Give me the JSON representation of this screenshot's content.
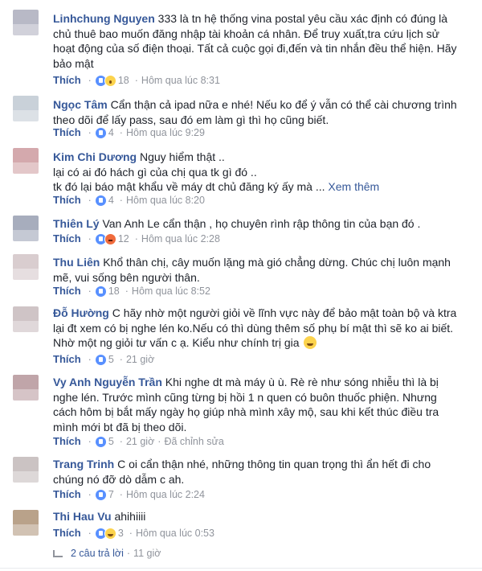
{
  "comments": [
    {
      "author": "Linhchung Nguyen",
      "lines": [
        "333 là tn hệ thống vina postal yêu cầu xác định có đúng là",
        "chủ thuê bao muốn đăng nhập tài khoản cá nhân. Để truy xuất,tra cứu lịch sử",
        "hoạt động của số điện thoại. Tất cả cuộc gọi đi,đến và tin nhắn đều thể hiện. Hãy",
        "bảo mật"
      ],
      "like": "Thích",
      "reaction_count": "18",
      "timestamp": "Hôm qua lúc 8:31",
      "reactions": [
        "like-icon",
        "wow-icon"
      ],
      "avatar_color": "#b8b9c6"
    },
    {
      "author": "Ngọc Tâm",
      "lines": [
        "Cẩn thận cả ipad nữa e nhé! Nếu ko để ý vẫn có thể cài chương trình",
        "theo dõi để lấy pass, sau đó em làm gì thì họ cũng biết."
      ],
      "like": "Thích",
      "reaction_count": "4",
      "timestamp": "Hôm qua lúc 9:29",
      "reactions": [
        "like-icon"
      ],
      "avatar_color": "#c9d1d9"
    },
    {
      "author": "Kim Chi Dương",
      "lines": [
        "Nguy hiểm thật ..",
        "lại có ai đó hách gì của chị qua tk gì đó ..",
        "tk đó lại báo mật khẩu về máy dt chủ đăng ký ấy mà ..."
      ],
      "more": "Xem thêm",
      "like": "Thích",
      "reaction_count": "4",
      "timestamp": "Hôm qua lúc 8:20",
      "reactions": [
        "like-icon"
      ],
      "avatar_color": "#d4a9ad"
    },
    {
      "author": "Thiên Lý",
      "lines": [
        "Van Anh Le cẩn thận , họ chuyên rình rập thông tin của bạn đó ."
      ],
      "like": "Thích",
      "reaction_count": "12",
      "timestamp": "Hôm qua lúc 2:28",
      "reactions": [
        "like-icon",
        "angry-icon"
      ],
      "avatar_color": "#a7adbd"
    },
    {
      "author": "Thu Liên",
      "lines": [
        "Khổ thân chị, cây muốn lặng mà gió chẳng dừng. Chúc chị luôn mạnh",
        "mẽ, vui sống bên người thân."
      ],
      "like": "Thích",
      "reaction_count": "18",
      "timestamp": "Hôm qua lúc 8:52",
      "reactions": [
        "like-icon"
      ],
      "avatar_color": "#d9cdcf"
    },
    {
      "author": "Đỗ Hường",
      "lines": [
        "C hãy nhờ một người giỏi về lĩnh vực này để bảo mật toàn bộ và ktra",
        "lại đt xem có bị nghe lén ko.Nếu có thì dùng thêm số phụ bí mật thì sẽ ko ai biết.",
        "Nhờ một ng giỏi tư vấn c ạ. Kiểu như chính trị gia"
      ],
      "like": "Thích",
      "reaction_count": "5",
      "timestamp": "21 giờ",
      "reactions": [
        "like-icon"
      ],
      "avatar_color": "#cfc4c6"
    },
    {
      "author": "Vy Anh Nguyễn Trần",
      "lines": [
        "Khi nghe dt mà máy ù ù. Rè rè như sóng nhiễu thì là bị",
        "nghe lén. Trước mình cũng từng bị hồi 1 n quen có buôn thuốc phiện. Nhưng",
        "cách hôm bị bắt mấy ngày họ giúp nhà mình xây mộ, sau khi kết thúc điều tra",
        "mình mới bt đã bị theo dõi."
      ],
      "like": "Thích",
      "reaction_count": "5",
      "timestamp": "21 giờ",
      "edited": "Đã chỉnh sửa",
      "reactions": [
        "like-icon"
      ],
      "avatar_color": "#c0a5a9"
    },
    {
      "author": "Trang Trinh",
      "lines": [
        "C oi cẩn thận nhé, những thông tin quan trọng thì ẩn hết đi cho",
        "chúng nó đỡ dò dẫm c ah."
      ],
      "like": "Thích",
      "reaction_count": "7",
      "timestamp": "Hôm qua lúc 2:24",
      "reactions": [
        "like-icon"
      ],
      "avatar_color": "#cbc3c3"
    },
    {
      "author": "Thi Hau Vu",
      "lines": [
        "ahihiiii"
      ],
      "like": "Thích",
      "reaction_count": "3",
      "timestamp": "Hôm qua lúc 0:53",
      "reactions": [
        "like-icon",
        "haha-icon"
      ],
      "avatar_color": "#b9a28a"
    }
  ],
  "replies": {
    "label": "2 câu trả lời",
    "time": "11 giờ"
  }
}
